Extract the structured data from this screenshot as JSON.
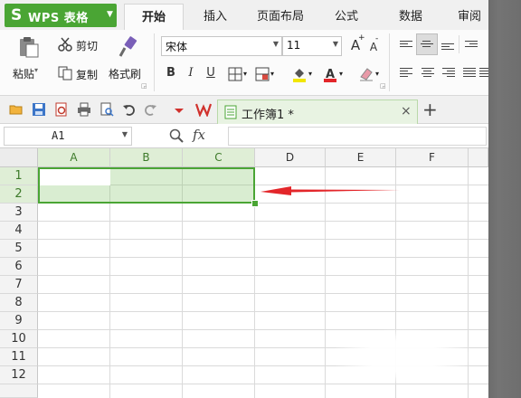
{
  "app": {
    "logo_glyph": "S",
    "title": "WPS 表格",
    "menu_arrow": "▼"
  },
  "menu_tabs": [
    {
      "label": "开始",
      "active": true
    },
    {
      "label": "插入"
    },
    {
      "label": "页面布局"
    },
    {
      "label": "公式"
    },
    {
      "label": "数据"
    },
    {
      "label": "审阅"
    }
  ],
  "ribbon": {
    "paste": "粘贴",
    "cut": "剪切",
    "copy": "复制",
    "format_painter": "格式刷",
    "font_name": "宋体",
    "font_size": "11",
    "bold": "B",
    "italic": "I",
    "underline": "U",
    "grow_font": "A",
    "shrink_font": "A"
  },
  "document_tab": {
    "title": "工作簿1 *",
    "close": "×"
  },
  "new_tab": "+",
  "formula_bar": {
    "name_box": "A1",
    "fx": "fx",
    "formula": ""
  },
  "sheet": {
    "columns": [
      "A",
      "B",
      "C",
      "D",
      "E",
      "F"
    ],
    "rows": [
      "1",
      "2",
      "3",
      "4",
      "5",
      "6",
      "7",
      "8",
      "9",
      "10",
      "11",
      "12"
    ],
    "selection": "A1:C2"
  },
  "colors": {
    "accent": "#4aa534",
    "arrow": "#e3262a",
    "selection_fill": "#dfeed6"
  }
}
